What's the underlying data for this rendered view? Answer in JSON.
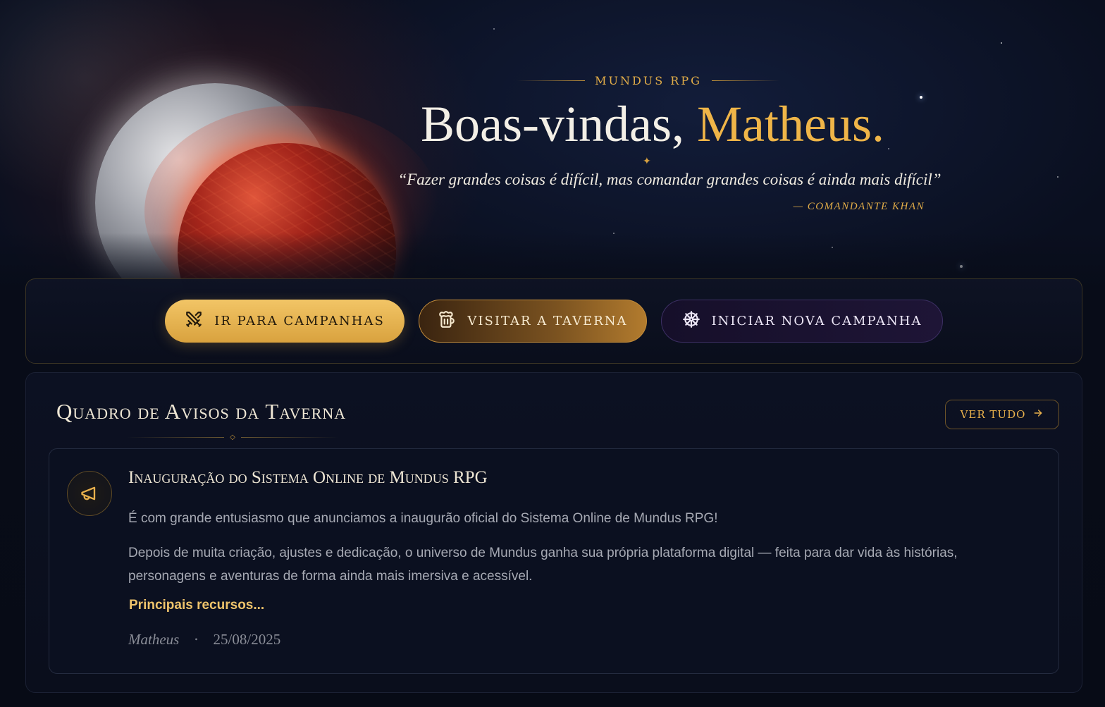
{
  "hero": {
    "eyebrow": "MUNDUS RPG",
    "greeting": "Boas-vindas,",
    "user_name": "Matheus.",
    "quote": "“Fazer grandes coisas é difícil, mas comandar grandes coisas é ainda mais difícil”",
    "quote_author": "— COMANDANTE KHAN"
  },
  "actions": {
    "campaigns_label": "IR PARA CAMPANHAS",
    "tavern_label": "VISITAR A TAVERNA",
    "new_campaign_label": "INICIAR NOVA CAMPANHA",
    "icons": [
      "crossed-swords-icon",
      "beer-mug-icon",
      "ship-wheel-icon"
    ]
  },
  "board": {
    "title": "Quadro de Avisos da Taverna",
    "see_all_label": "VER TUDO",
    "notice": {
      "icon": "megaphone-icon",
      "title": "Inauguração do Sistema Online de Mundus RPG",
      "paragraph1": "É com grande entusiasmo que anunciamos a inaugurão oficial do Sistema Online de Mundus RPG!",
      "paragraph2": "Depois de muita criação, ajustes e dedicação, o universo de Mundus ganha sua própria plataforma digital — feita para dar vida às histórias, personagens e aventuras de forma ainda mais imersiva e acessível.",
      "link_label": "Principais recursos...",
      "author": "Matheus",
      "date": "25/08/2025"
    }
  },
  "colors": {
    "accent_gold": "#efb548",
    "background": "#080c18",
    "text_light": "#eee6d4",
    "text_muted": "#a6a9b3"
  }
}
